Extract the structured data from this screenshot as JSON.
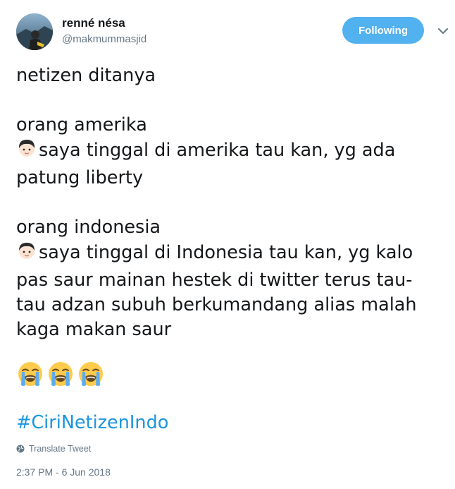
{
  "user": {
    "display_name": "renné nésa",
    "handle": "@makmummasjid",
    "avatar_icon": "avatar-photo"
  },
  "follow_button": {
    "label": "Following",
    "color": "#52b1ef"
  },
  "menu": {
    "icon": "chevron-down-icon"
  },
  "tweet": {
    "line1": "netizen ditanya",
    "line2": "orang amerika",
    "line3": "saya tinggal di amerika tau kan, yg ada",
    "line4": "patung liberty",
    "line5": "orang indonesia",
    "line6": "saya tinggal di Indonesia tau kan, yg kalo",
    "line7": "pas saur mainan hestek di twitter terus tau-",
    "line8": "tau adzan subuh berkumandang alias malah",
    "line9": "kaga makan saur",
    "hashtag": "#CiriNetizenIndo",
    "emoji_face": "boy-face-emoji",
    "emoji_crying": "loudly-crying-face-emoji"
  },
  "translate": {
    "label": "Translate Tweet",
    "icon": "globe-icon"
  },
  "timestamp": "2:37 PM - 6 Jun 2018",
  "colors": {
    "link": "#1b95e0",
    "secondary_text": "#657786",
    "primary_text": "#14171a"
  }
}
